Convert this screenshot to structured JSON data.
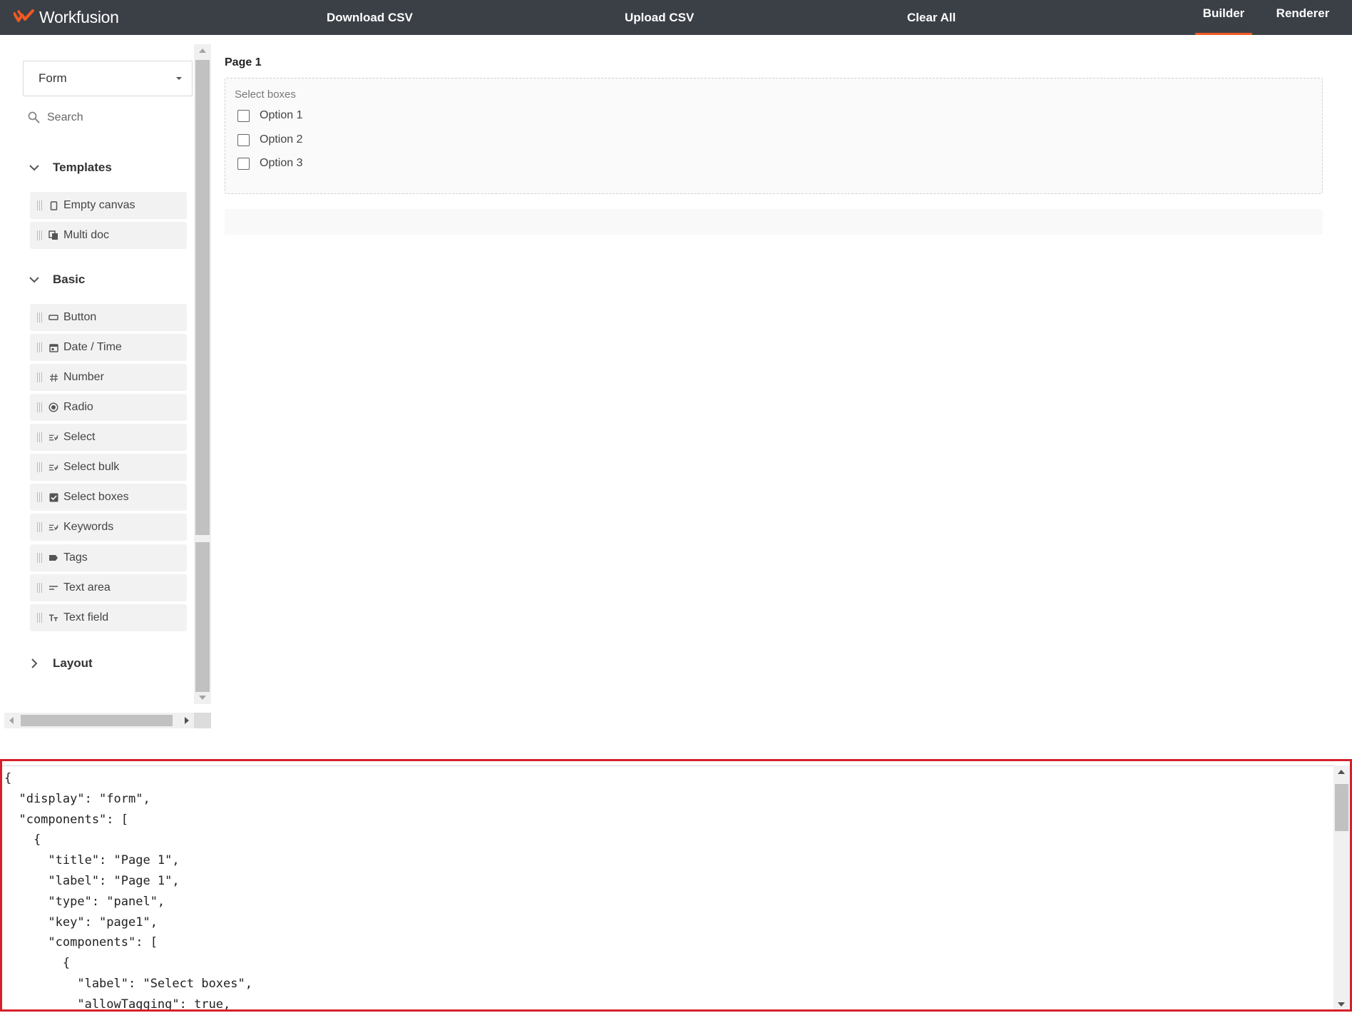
{
  "header": {
    "brand": "Workfusion",
    "brand_color": "#f05a22",
    "bg_color": "#3b3f46",
    "actions": {
      "download_csv": "Download CSV",
      "upload_csv": "Upload CSV",
      "clear_all": "Clear All"
    },
    "tabs": {
      "builder": "Builder",
      "renderer": "Renderer",
      "active": "Builder"
    }
  },
  "sidebar": {
    "form_type_select": {
      "value": "Form"
    },
    "search": {
      "placeholder": "Search"
    },
    "groups": {
      "templates": {
        "title": "Templates",
        "expanded": true,
        "items": [
          {
            "label": "Empty canvas",
            "icon": "document-icon"
          },
          {
            "label": "Multi doc",
            "icon": "copy-icon"
          }
        ]
      },
      "basic": {
        "title": "Basic",
        "expanded": true,
        "items": [
          {
            "label": "Button",
            "icon": "button-icon"
          },
          {
            "label": "Date / Time",
            "icon": "calendar-icon"
          },
          {
            "label": "Number",
            "icon": "hash-icon"
          },
          {
            "label": "Radio",
            "icon": "radio-icon"
          },
          {
            "label": "Select",
            "icon": "list-check-icon"
          },
          {
            "label": "Select bulk",
            "icon": "list-check-icon"
          },
          {
            "label": "Select boxes",
            "icon": "checkbox-icon"
          },
          {
            "label": "Keywords",
            "icon": "list-check-icon"
          },
          {
            "label": "Tags",
            "icon": "tag-icon"
          },
          {
            "label": "Text area",
            "icon": "text-lines-icon"
          },
          {
            "label": "Text field",
            "icon": "text-size-icon"
          }
        ]
      },
      "layout": {
        "title": "Layout",
        "expanded": false
      }
    }
  },
  "canvas": {
    "page_title": "Page 1",
    "select_boxes": {
      "label": "Select boxes",
      "options": [
        "Option 1",
        "Option 2",
        "Option 3"
      ]
    }
  },
  "json_editor": {
    "lines": [
      "{",
      "  \"display\": \"form\",",
      "  \"components\": [",
      "    {",
      "      \"title\": \"Page 1\",",
      "      \"label\": \"Page 1\",",
      "      \"type\": \"panel\",",
      "      \"key\": \"page1\",",
      "      \"components\": [",
      "        {",
      "          \"label\": \"Select boxes\",",
      "          \"allowTagging\": true,"
    ],
    "highlight_color": "#d6202a"
  }
}
